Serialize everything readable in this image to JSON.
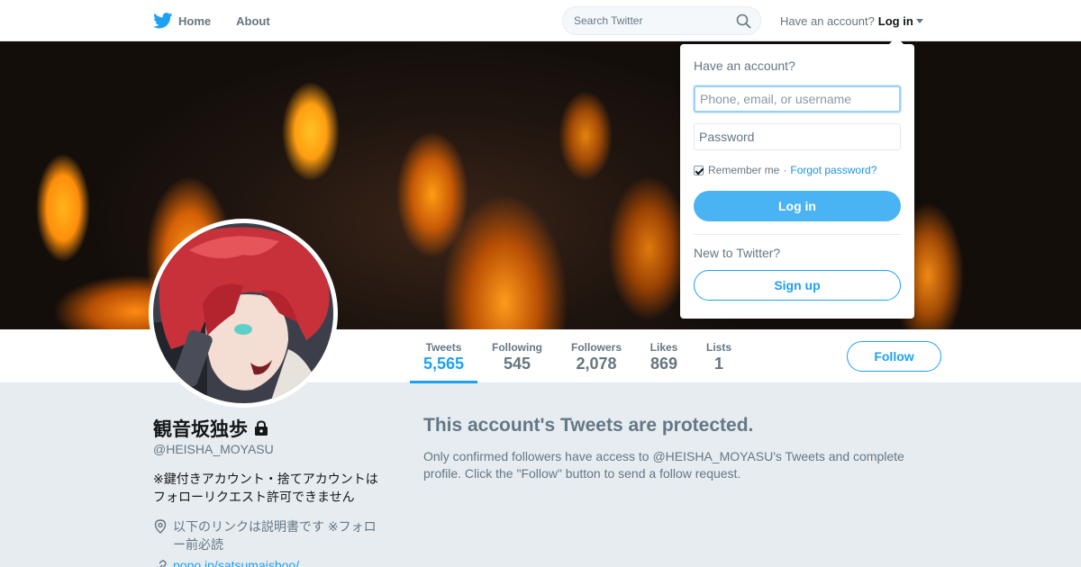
{
  "nav": {
    "home_label": "Home",
    "about_label": "About",
    "logo_icon": "twitter-bird-icon",
    "brand_color": "#1da1f2"
  },
  "search": {
    "placeholder": "Search Twitter",
    "icon": "search-icon"
  },
  "login_menu": {
    "prompt": "Have an account?",
    "login_label": "Log in"
  },
  "dropdown": {
    "heading": "Have an account?",
    "username_placeholder": "Phone, email, or username",
    "password_placeholder": "Password",
    "remember_label": "Remember me",
    "separator": "·",
    "forgot_label": "Forgot password?",
    "login_button": "Log in",
    "new_prompt": "New to Twitter?",
    "signup_button": "Sign up"
  },
  "stats": [
    {
      "label": "Tweets",
      "value": "5,565",
      "active": true
    },
    {
      "label": "Following",
      "value": "545"
    },
    {
      "label": "Followers",
      "value": "2,078"
    },
    {
      "label": "Likes",
      "value": "869"
    },
    {
      "label": "Lists",
      "value": "1"
    }
  ],
  "follow_button": "Follow",
  "profile": {
    "name": "観音坂独歩",
    "handle": "@HEISHA_MOYASU",
    "bio": "※鍵付きアカウント・捨てアカウントはフォローリクエスト許可できません",
    "location": "以下のリンクは説明書です ※フォロー前必読",
    "url": "popo.jp/satsumaisboo/"
  },
  "protected": {
    "title": "This account's Tweets are protected.",
    "text": "Only confirmed followers have access to @HEISHA_MOYASU's Tweets and complete profile. Click the \"Follow\" button to send a follow request."
  }
}
